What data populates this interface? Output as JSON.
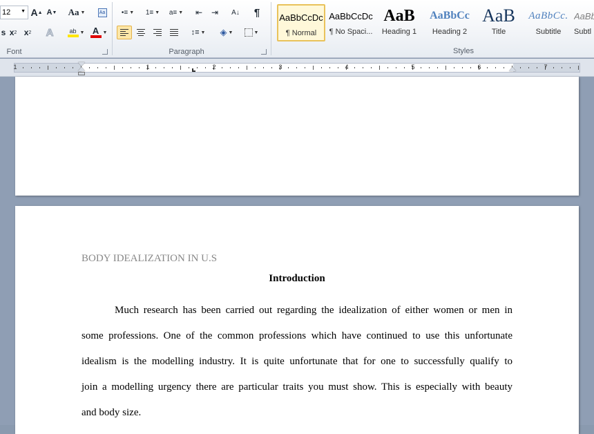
{
  "ribbon": {
    "font_group": {
      "label": "Font",
      "font_size": "12",
      "grow_font": "A",
      "shrink_font": "A",
      "change_case": "Aa",
      "subscript": "x",
      "superscript": "x",
      "text_effects": "A",
      "highlight": "ab",
      "font_color": "A",
      "highlight_color": "#ffe600",
      "font_color_value": "#e00000"
    },
    "paragraph_group": {
      "label": "Paragraph",
      "sort": "A↓",
      "show_marks": "¶"
    },
    "styles_group": {
      "label": "Styles",
      "tiles": [
        {
          "sample": "AaBbCcDc",
          "name": "¶ Normal"
        },
        {
          "sample": "AaBbCcDc",
          "name": "¶ No Spaci..."
        },
        {
          "sample": "AaB",
          "name": "Heading 1"
        },
        {
          "sample": "AaBbCc",
          "name": "Heading 2"
        },
        {
          "sample": "AaB",
          "name": "Title"
        },
        {
          "sample": "AaBbCc.",
          "name": "Subtitle"
        },
        {
          "sample": "AaBbCcDc",
          "name": "Subtl"
        }
      ]
    }
  },
  "ruler": {
    "numbers": [
      "1",
      "1",
      "2",
      "3",
      "4",
      "5",
      "6",
      "7"
    ]
  },
  "document": {
    "header_text": "BODY IDEALIZATION IN U.S",
    "heading": "Introduction",
    "paragraph_lines": [
      "Much research has been carried out regarding the idealization of either women or men in",
      "some professions. One of the common professions which have continued to use this unfortunate",
      "idealism is the modelling industry. It is quite unfortunate that for one to successfully qualify to",
      "join a modelling urgency there are particular traits you must show. This is especially with beauty",
      "and body size."
    ]
  }
}
